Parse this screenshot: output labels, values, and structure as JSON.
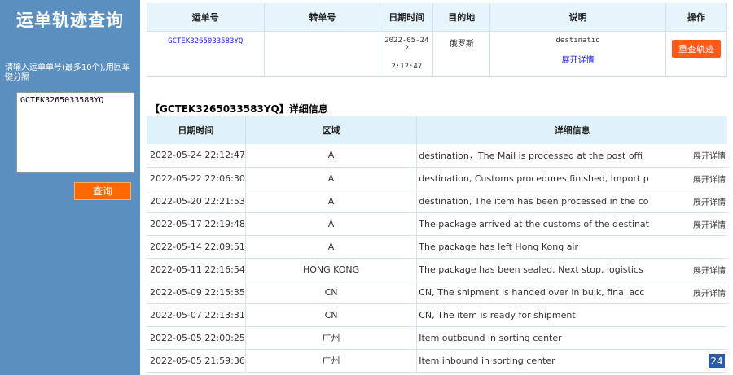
{
  "sidebar": {
    "title": "运单轨迹查询",
    "label": "请输入运单单号(最多10个),用回车键分隔",
    "textarea_value": "GCTEK3265033583YQ",
    "query_button": "查询"
  },
  "summary": {
    "headers": [
      "运单号",
      "转单号",
      "日期时间",
      "目的地",
      "说明",
      "操作"
    ],
    "row": {
      "tracking_no": "GCTEK3265033583YQ",
      "transfer_no": "",
      "datetime_line1": "2022-05-24 2",
      "datetime_line2": "2:12:47",
      "destination": "俄罗斯",
      "note": "destinatio",
      "expand_link": "展开详情",
      "requery_button": "重查轨迹"
    }
  },
  "detail": {
    "title": "【GCTEK3265033583YQ】详细信息",
    "headers": [
      "日期时间",
      "区域",
      "详细信息"
    ],
    "rows": [
      {
        "time": "2022-05-24 22:12:47",
        "area": "A",
        "info": "destination，The Mail is processed at the post offi",
        "link": "展开详情"
      },
      {
        "time": "2022-05-22 22:06:30",
        "area": "A",
        "info": "destination, Customs procedures finished, Import p",
        "link": "展开详情"
      },
      {
        "time": "2022-05-20 22:21:53",
        "area": "A",
        "info": "destination, The item has been processed in the co",
        "link": "展开详情"
      },
      {
        "time": "2022-05-17 22:19:48",
        "area": "A",
        "info": "The package arrived at the customs of the destinat",
        "link": "展开详情"
      },
      {
        "time": "2022-05-14 22:09:51",
        "area": "A",
        "info": " The package has left Hong Kong air",
        "link": ""
      },
      {
        "time": "2022-05-11 22:16:54",
        "area": "HONG KONG",
        "info": "The package has been sealed. Next stop, logistics",
        "link": "展开详情"
      },
      {
        "time": "2022-05-09 22:15:35",
        "area": "CN",
        "info": "CN, The shipment is handed over in bulk, final acc",
        "link": "展开详情"
      },
      {
        "time": "2022-05-07 22:13:31",
        "area": "CN",
        "info": " CN, The item is ready for shipment",
        "link": ""
      },
      {
        "time": "2022-05-05 22:00:25",
        "area": "广州",
        "info": " Item outbound in sorting center",
        "link": ""
      },
      {
        "time": "2022-05-05 21:59:36",
        "area": "广州",
        "info": " Item inbound in sorting center",
        "link": ""
      }
    ]
  },
  "page_badge": "24"
}
